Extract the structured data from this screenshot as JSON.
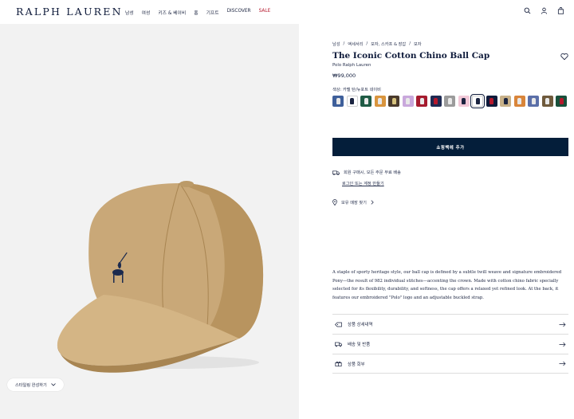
{
  "header": {
    "logo": "RALPH LAUREN",
    "nav": [
      "남성",
      "여성",
      "키즈 & 베이비",
      "홈",
      "기프트",
      "DISCOVER",
      "SALE"
    ]
  },
  "image_panel": {
    "styling_button": "스타일링 완성하기"
  },
  "product": {
    "breadcrumbs": [
      "남성",
      "/",
      "액세서리",
      "/",
      "모자, 스카프 & 장갑",
      "/",
      "모자"
    ],
    "title": "The Iconic Cotton Chino Ball Cap",
    "brand": "Polo Ralph Lauren",
    "price": "₩99,000",
    "color_label": "색상: 카멜 탄/뉴포트 네이비",
    "swatches": [
      {
        "bg": "#3e5f9a",
        "pony": "#e8e8e8"
      },
      {
        "bg": "#ffffff",
        "pony": "#1b2440",
        "selected": false
      },
      {
        "bg": "#1f5b45",
        "pony": "#e8e8e8"
      },
      {
        "bg": "#d9953e",
        "pony": "#e8e8e8"
      },
      {
        "bg": "#4a3a2c",
        "pony": "#d6c27e"
      },
      {
        "bg": "#c9a8dc",
        "pony": "#e8e8e8"
      },
      {
        "bg": "#a51b2e",
        "pony": "#e8e8e8"
      },
      {
        "bg": "#1e2a52",
        "pony": "#b5182c"
      },
      {
        "bg": "#9b9b9b",
        "pony": "#e8e8e8"
      },
      {
        "bg": "#f2c9d8",
        "pony": "#1b2440"
      },
      {
        "bg": "#ffffff",
        "pony": "#1b2440",
        "selected": true
      },
      {
        "bg": "#0f1b3b",
        "pony": "#b5182c"
      },
      {
        "bg": "#c8b189",
        "pony": "#1b2440"
      },
      {
        "bg": "#d9853a",
        "pony": "#e8e8e8"
      },
      {
        "bg": "#5b6fa8",
        "pony": "#e8e8e8"
      },
      {
        "bg": "#6f5a3c",
        "pony": "#e8e8e8"
      },
      {
        "bg": "#18503b",
        "pony": "#b5182c"
      }
    ],
    "add_to_bag": "쇼핑백에 추가",
    "shipping": "회원 구매시, 모든 주문 무료 배송",
    "login_link": "로그인 또는 계정 만들기",
    "store": "보유 매장 찾기",
    "description": "A staple of sporty heritage style, our ball cap is defined by a subtle twill weave and signature embroidered Pony—the result of 982 individual stitches—accenting the crown. Made with cotton chino fabric specially selected for its flexibility, durability, and softness, the cap offers a relaxed yet refined look. At the back, it features our embroidered \"Polo\" logo and an adjustable buckled strap.",
    "accordion": [
      "상품 상세내역",
      "배송 및 반품",
      "상품 회부"
    ]
  },
  "colors": {
    "navy": "#041e3a",
    "sale_red": "#b5182c",
    "cap_khaki": "#c9a878"
  }
}
